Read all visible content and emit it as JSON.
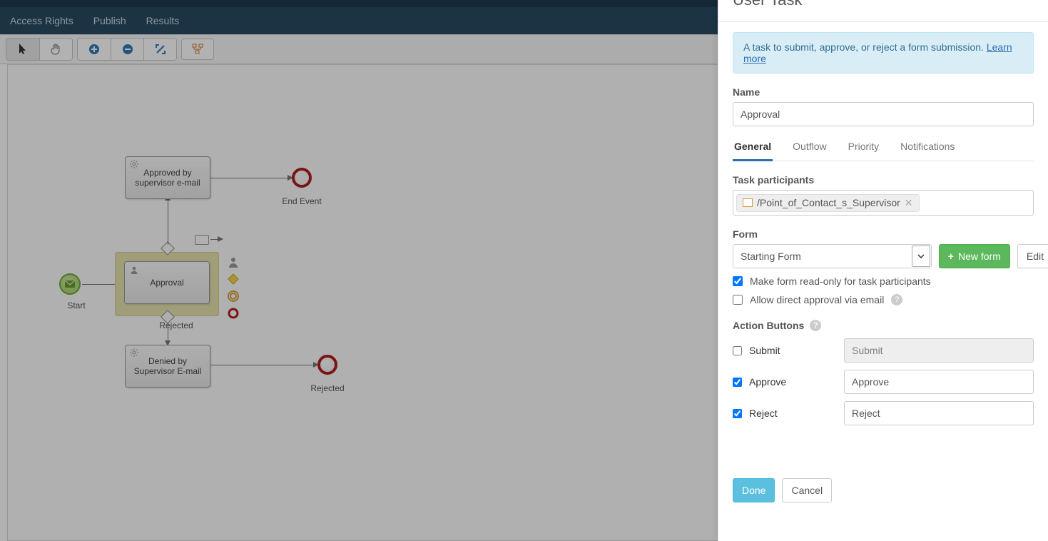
{
  "nav": {
    "access_rights": "Access Rights",
    "publish": "Publish",
    "results": "Results"
  },
  "diagram": {
    "start_label": "Start",
    "approval_task": "Approval",
    "approved_task_line1": "Approved by",
    "approved_task_line2": "supervisor e-mail",
    "denied_task_line1": "Denied by",
    "denied_task_line2": "Supervisor E-mail",
    "rejected_label": "Rejected",
    "end_event_label": "End Event",
    "rejected_end_label": "Rejected"
  },
  "panel": {
    "title": "User Task",
    "info_text": "A task to submit, approve, or reject a form submission. ",
    "info_link": "Learn more",
    "name_label": "Name",
    "name_value": "Approval",
    "tabs": {
      "general": "General",
      "outflow": "Outflow",
      "priority": "Priority",
      "notifications": "Notifications"
    },
    "participants_label": "Task participants",
    "participant_token": "/Point_of_Contact_s_Supervisor",
    "form_label": "Form",
    "form_selected": "Starting Form",
    "new_form_btn": "New form",
    "edit_btn": "Edit",
    "readonly_label": "Make form read-only for task participants",
    "direct_approval_label": "Allow direct approval via email",
    "action_buttons_label": "Action Buttons",
    "actions": {
      "submit": {
        "label": "Submit",
        "value": "Submit",
        "checked": false
      },
      "approve": {
        "label": "Approve",
        "value": "Approve",
        "checked": true
      },
      "reject": {
        "label": "Reject",
        "value": "Reject",
        "checked": true
      }
    },
    "done_btn": "Done",
    "cancel_btn": "Cancel"
  }
}
